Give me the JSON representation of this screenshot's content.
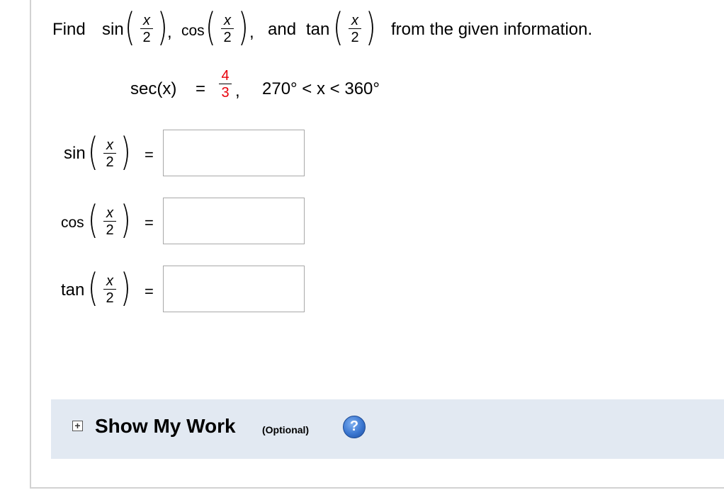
{
  "question": {
    "intro": "Find",
    "sin_fn": "sin",
    "cos_fn": "cos",
    "tan_fn": "tan",
    "comma1": ",",
    "comma2": ",",
    "and": "and",
    "tail": "from the given information.",
    "frac_num": "x",
    "frac_den": "2"
  },
  "given": {
    "lhs": "sec(x)",
    "eq": "=",
    "num": "4",
    "den": "3",
    "comma": ",",
    "range": "270° < x < 360°",
    "highlight_color": "#e8000b"
  },
  "answers": [
    {
      "fn": "sin",
      "frac_num": "x",
      "frac_den": "2",
      "eq": "=",
      "value": ""
    },
    {
      "fn": "cos",
      "frac_num": "x",
      "frac_den": "2",
      "eq": "=",
      "value": ""
    },
    {
      "fn": "tan",
      "frac_num": "x",
      "frac_den": "2",
      "eq": "=",
      "value": ""
    }
  ],
  "show_my_work": {
    "expand_icon": "plus-box-icon",
    "label": "Show My Work",
    "optional": "(Optional)",
    "help_icon": "question-circle-icon",
    "help_glyph": "?",
    "panel_color": "#e2e9f2"
  }
}
